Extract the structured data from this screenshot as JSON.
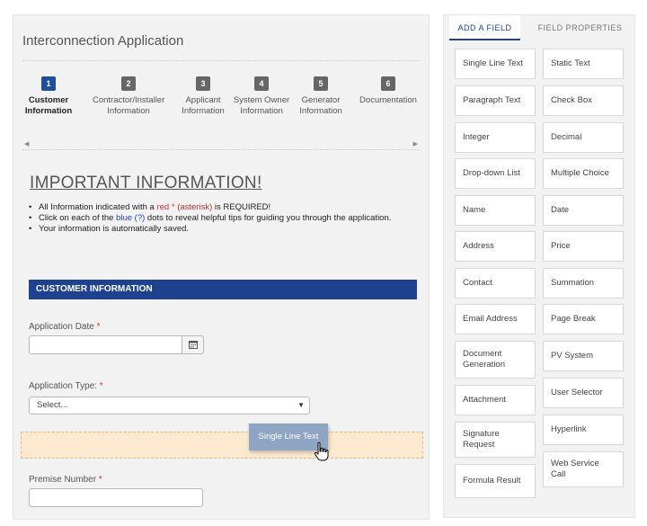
{
  "form": {
    "title": "Interconnection Application",
    "steps": [
      {
        "num": "1",
        "label": "Customer Information",
        "active": true
      },
      {
        "num": "2",
        "label": "Contractor/Installer Information",
        "active": false
      },
      {
        "num": "3",
        "label": "Applicant Information",
        "active": false
      },
      {
        "num": "4",
        "label": "System Owner Information",
        "active": false
      },
      {
        "num": "5",
        "label": "Generator Information",
        "active": false
      },
      {
        "num": "6",
        "label": "Documentation",
        "active": false
      }
    ],
    "important_heading": "IMPORTANT INFORMATION!",
    "info": {
      "line1_pre": "All Information indicated with a ",
      "line1_red": "red * (asterisk)",
      "line1_post": " is REQUIRED!",
      "line2_pre": "Click on each of the ",
      "line2_blue": "blue (?)",
      "line2_post": " dots to reveal helpful tips for guiding you through the application.",
      "line3": "Your information is automatically saved."
    },
    "section_title": "CUSTOMER INFORMATION",
    "application_date": {
      "label": "Application Date",
      "required_mark": "*",
      "value": ""
    },
    "application_type": {
      "label": "Application Type:",
      "required_mark": "*",
      "selected": "Select..."
    },
    "premise_number": {
      "label": "Premise Number",
      "required_mark": "*",
      "value": ""
    },
    "drag_ghost_label": "Single Line Text"
  },
  "panel": {
    "tabs": [
      {
        "label": "ADD A FIELD",
        "active": true
      },
      {
        "label": "FIELD PROPERTIES",
        "active": false
      }
    ],
    "fields_left": [
      "Single Line Text",
      "Paragraph Text",
      "Integer",
      "Drop-down List",
      "Name",
      "Address",
      "Contact",
      "Email Address",
      "Document Generation",
      "Attachment",
      "Signature Request",
      "Formula Result"
    ],
    "fields_right": [
      "Static Text",
      "Check Box",
      "Decimal",
      "Multiple Choice",
      "Date",
      "Price",
      "Summation",
      "Page Break",
      "PV System",
      "User Selector",
      "Hyperlink",
      "Web Service Call"
    ]
  },
  "colors": {
    "accent": "#1f4290",
    "step_active": "#1f4f9c",
    "required": "#d33333",
    "drop_zone": "#fde8d0"
  },
  "icons": {
    "calendar": "calendar-icon",
    "dropdown": "chevron-down-icon",
    "cursor": "hand-pointer-icon"
  }
}
